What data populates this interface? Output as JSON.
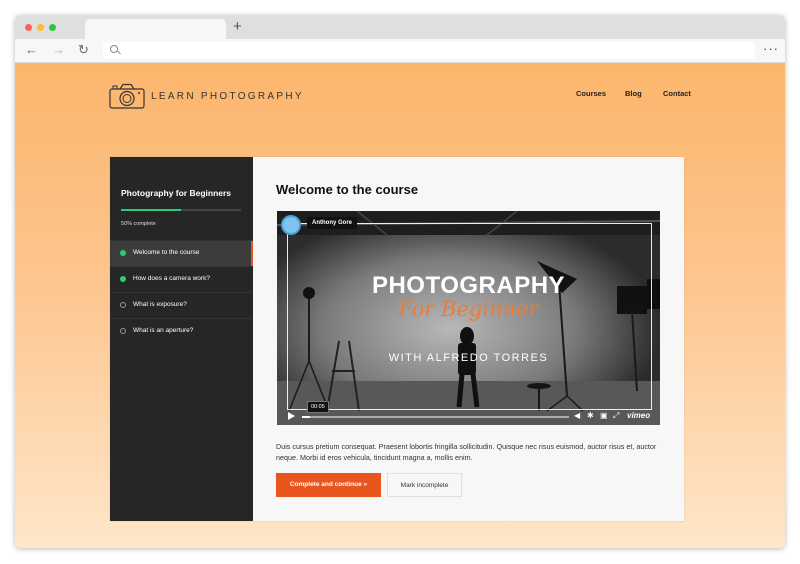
{
  "browser": {
    "new_tab_symbol": "+",
    "back_symbol": "←",
    "forward_symbol": "→",
    "reload_symbol": "↻",
    "menu_symbol": "···"
  },
  "site": {
    "logo_text": "LEARN PHOTOGRAPHY",
    "nav": [
      "Courses",
      "Blog",
      "Contact"
    ]
  },
  "sidebar": {
    "course_title": "Photography for Beginners",
    "progress_percent": 50,
    "progress_text": "50% complete",
    "lessons": [
      {
        "label": "Welcome to the course",
        "completed": true,
        "active": true
      },
      {
        "label": "How does a camera work?",
        "completed": true,
        "active": false
      },
      {
        "label": "What is exposure?",
        "completed": false,
        "active": false
      },
      {
        "label": "What is an aperture?",
        "completed": false,
        "active": false
      }
    ]
  },
  "lesson": {
    "title": "Welcome to the course",
    "video": {
      "author": "Anthony Gore",
      "title": "PHOTOGRAPHY",
      "script": "For Beginner",
      "subtitle": "WITH ALFREDO TORRES",
      "timestamp": "00:05",
      "progress_fraction": 0.03,
      "brand": "vimeo"
    },
    "description": "Duis cursus pretium consequat. Praesent lobortis fringilla sollicitudin. Quisque nec risus euismod, auctor risus et, auctor neque. Morbi id eros vehicula, tincidunt magna a, mollis enim.",
    "complete_button": "Complete and continue »",
    "incomplete_button": "Mark incomplete"
  },
  "colors": {
    "accent": "#e8561e",
    "progress": "#2ecc71",
    "sidebar_bg": "#262626",
    "script_orange": "#ef7a32"
  }
}
